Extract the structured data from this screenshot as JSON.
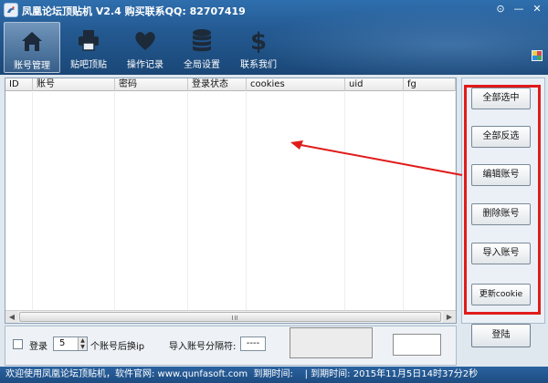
{
  "window": {
    "title": "凤凰论坛顶贴机 V2.4 购买联系QQ: 82707419",
    "controls": [
      "⊙",
      "—",
      "✕"
    ]
  },
  "nav": {
    "items": [
      {
        "label": "账号管理",
        "icon": "home-icon"
      },
      {
        "label": "贴吧顶贴",
        "icon": "printer-icon"
      },
      {
        "label": "操作记录",
        "icon": "heart-icon"
      },
      {
        "label": "全局设置",
        "icon": "database-icon"
      },
      {
        "label": "联系我们",
        "icon": "dollar-icon"
      }
    ],
    "active": 0
  },
  "table": {
    "columns": [
      "ID",
      "账号",
      "密码",
      "登录状态",
      "cookies",
      "uid",
      "fg"
    ],
    "rows": [],
    "scroll_grip": "|||"
  },
  "side_buttons": {
    "select_all": "全部选中",
    "invert_all": "全部反选",
    "edit_account": "编辑账号",
    "delete_account": "删除账号",
    "import_account": "导入账号",
    "update_cookie": "更新cookie"
  },
  "bottom": {
    "login_checkbox_label": "登录",
    "spin_value": "5",
    "spin_suffix": "个账号后换ip",
    "separator_label": "导入账号分隔符:",
    "separator_value": "----",
    "login_button": "登陆"
  },
  "status": {
    "welcome": "欢迎使用凤凰论坛顶贴机，软件官网: www.qunfasoft.com",
    "expire_label": "到期时间:",
    "expire_label2": "| 到期时间:",
    "expire_value": "2015年11月5日14时37分2秒"
  },
  "colors": {
    "header": "#245a92",
    "highlight_frame": "#e01b1b",
    "annotation_arrow": "#e01b1b"
  }
}
